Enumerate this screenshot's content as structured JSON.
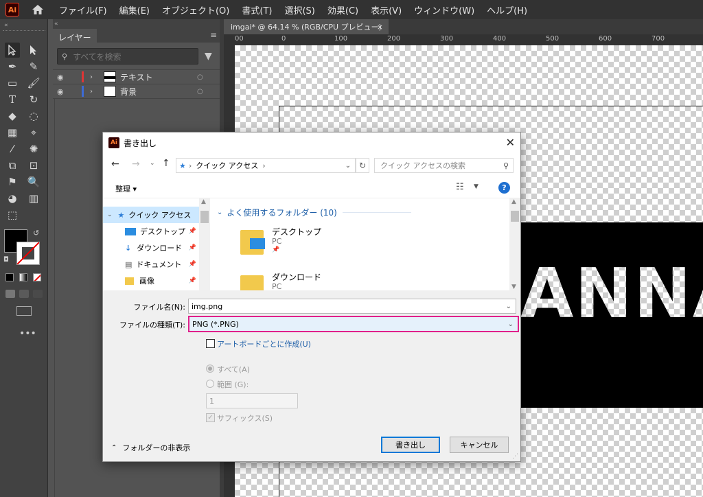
{
  "app": {
    "logo_text": "Ai",
    "menu": [
      "ファイル(F)",
      "編集(E)",
      "オブジェクト(O)",
      "書式(T)",
      "選択(S)",
      "効果(C)",
      "表示(V)",
      "ウィンドウ(W)",
      "ヘルプ(H)"
    ]
  },
  "layers": {
    "tab_label": "レイヤー",
    "search_placeholder": "すべてを検索",
    "items": [
      {
        "name": "テキスト",
        "color": "#e03535"
      },
      {
        "name": "背景",
        "color": "#3d6bd6"
      }
    ]
  },
  "document": {
    "tab_title": "imgai* @ 64.14 % (RGB/CPU プレビュー)",
    "ruler_labels": [
      "00",
      "0",
      "100",
      "200",
      "300",
      "400",
      "500",
      "600",
      "700"
    ],
    "canvas_text": "ANNA"
  },
  "dialog": {
    "title": "書き出し",
    "path_root": "クイック アクセス",
    "search_placeholder": "クイック アクセスの検索",
    "organize": "整理 ▾",
    "sidebar": [
      {
        "label": "クイック アクセス",
        "icon": "star-icon"
      },
      {
        "label": "デスクトップ",
        "icon": "desktop-icon"
      },
      {
        "label": "ダウンロード",
        "icon": "download-icon"
      },
      {
        "label": "ドキュメント",
        "icon": "document-icon"
      },
      {
        "label": "画像",
        "icon": "folder-icon"
      }
    ],
    "group_header": "よく使用するフォルダー (10)",
    "folders": [
      {
        "name": "デスクトップ",
        "sub": "PC"
      },
      {
        "name": "ダウンロード",
        "sub": "PC"
      }
    ],
    "filename_label": "ファイル名(N):",
    "filename_value": "img.png",
    "filetype_label": "ファイルの種類(T):",
    "filetype_value": "PNG (*.PNG)",
    "artboard_checkbox": "アートボードごとに作成(U)",
    "radio_all": "すべて(A)",
    "radio_range": "範囲 (G):",
    "range_value": "1",
    "suffix": "サフィックス(S)",
    "hide_folders": "フォルダーの非表示",
    "export_button": "書き出し",
    "cancel_button": "キャンセル",
    "highlight_color": "#e0208a"
  }
}
